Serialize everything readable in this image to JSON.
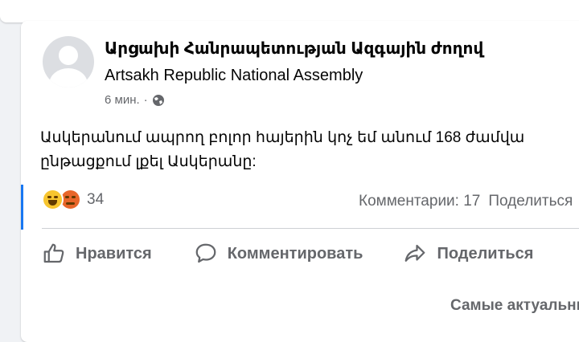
{
  "post": {
    "author_name": "Արցախի Հանրապետության Ազգային ժողով",
    "author_subtitle": "Artsakh Republic National Assembly",
    "time": "6 мин.",
    "separator": "·",
    "privacy_icon": "globe-icon",
    "text_line1": "Ասկերանում ապրող բոլոր հայերին կոչ եմ անում 168 ժամվա",
    "text_line2": "ընթացքում լքել Ասկերանը:"
  },
  "reactions": {
    "icons": [
      "haha-reaction-icon",
      "angry-reaction-icon"
    ],
    "count": "34"
  },
  "stats": {
    "comments": "Комментарии: 17",
    "shares": "Поделиться"
  },
  "actions": {
    "like": "Нравится",
    "comment": "Комментировать",
    "share": "Поделиться"
  },
  "sort": {
    "label": "Самые актуальные"
  },
  "colors": {
    "accent": "#1877f2",
    "secondary_text": "#65676b",
    "primary_text": "#050505",
    "background": "#f0f2f5"
  }
}
